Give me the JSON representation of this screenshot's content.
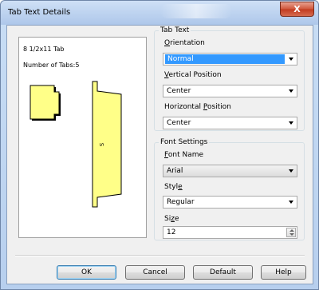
{
  "window": {
    "title": "Tab Text Details",
    "close_glyph": "X"
  },
  "preview": {
    "paper_size": "8 1/2x11 Tab",
    "tabs_count": "Number of Tabs:5",
    "tab_text_sample": "S"
  },
  "tab_text_group": {
    "title": "Tab Text",
    "orientation": {
      "label": "Orientation",
      "mnemonic": "O",
      "value": "Normal"
    },
    "vertical_position": {
      "label": "Vertical Position",
      "mnemonic": "V",
      "value": "Center"
    },
    "horizontal_position": {
      "label": "Horizontal Position",
      "mnemonic": "P",
      "value": "Center"
    }
  },
  "font_settings_group": {
    "title": "Font Settings",
    "font_name": {
      "label": "Font Name",
      "mnemonic": "F",
      "value": "Arial"
    },
    "style": {
      "label": "Style",
      "mnemonic": "e",
      "value": "Regular"
    },
    "size": {
      "label": "Size",
      "mnemonic": "z",
      "value": "12"
    }
  },
  "buttons": {
    "ok": "OK",
    "cancel": "Cancel",
    "default": "Default",
    "help": "Help"
  },
  "colors": {
    "accent": "#3399ff",
    "tab_fill": "#ffff88"
  },
  "icons": {
    "close": "close-icon",
    "dropdown": "chevron-down-icon",
    "spin": "spin-icon"
  }
}
